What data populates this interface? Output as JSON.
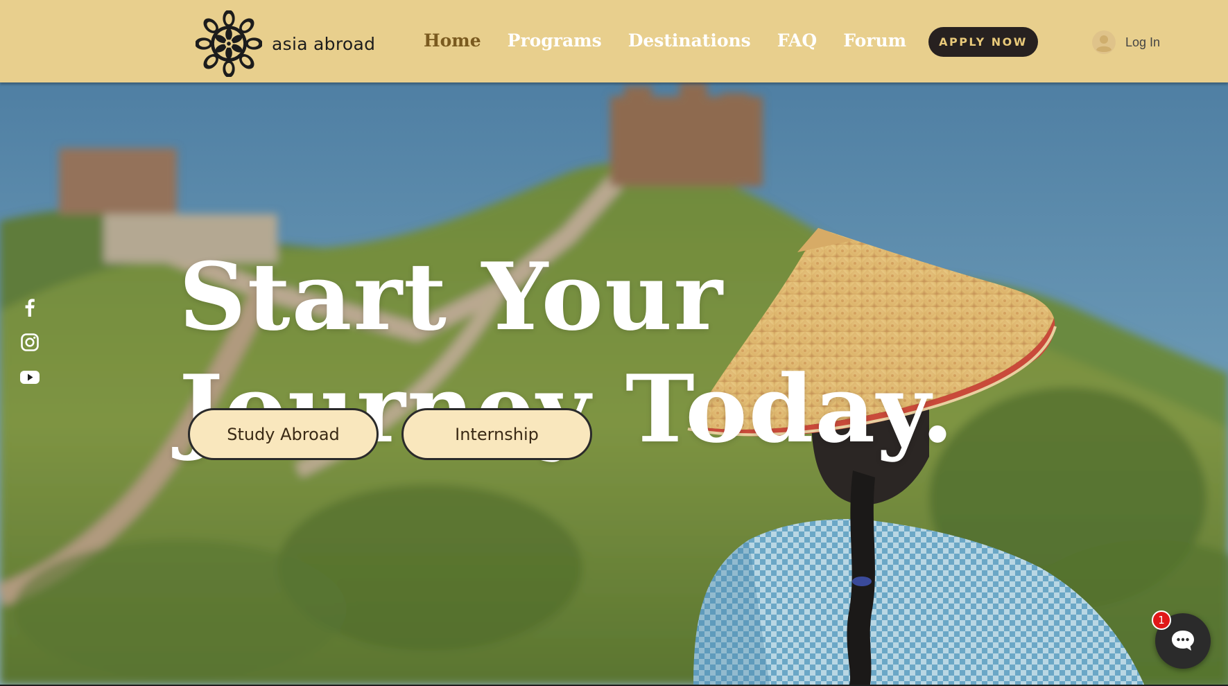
{
  "header": {
    "brand_name": "asia abroad",
    "logo_icon": "mandala-logo-icon",
    "nav_items": [
      {
        "label": "Home",
        "active": true
      },
      {
        "label": "Programs",
        "active": false
      },
      {
        "label": "Destinations",
        "active": false
      },
      {
        "label": "FAQ",
        "active": false
      },
      {
        "label": "Forum",
        "active": false
      }
    ],
    "apply_label": "APPLY NOW",
    "login_label": "Log In",
    "colors": {
      "background": "#e8cf8d",
      "nav_active": "#7a5a1f",
      "apply_bg": "#272120",
      "apply_text": "#e8c97a"
    }
  },
  "hero": {
    "headline_line1": "Start Your",
    "headline_line2": "Journey Today.",
    "buttons": [
      {
        "label": "Study Abroad"
      },
      {
        "label": "Internship"
      }
    ],
    "button_color": "#f9e7bd"
  },
  "social": {
    "icons": [
      "facebook-icon",
      "instagram-icon",
      "youtube-icon"
    ]
  },
  "chat": {
    "icon": "chat-bubble-icon",
    "badge_count": "1"
  }
}
